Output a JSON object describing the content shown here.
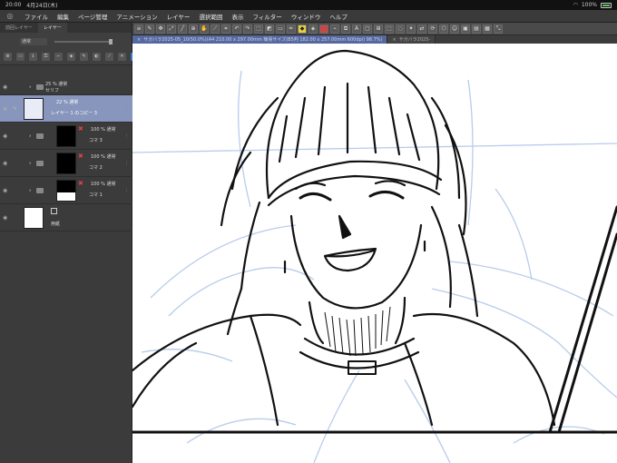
{
  "status": {
    "time": "20:00",
    "date": "4月24日(木)",
    "battery": "100%"
  },
  "menu": {
    "items": [
      "ファイル",
      "編集",
      "ページ管理",
      "アニメーション",
      "レイヤー",
      "選択範囲",
      "表示",
      "フィルター",
      "ウィンドウ",
      "ヘルプ"
    ]
  },
  "doc": {
    "active_tab": "サガバラ2025-05_10(50.0%)(A4 210.00 x 297.00mm 簡易サイズ(B5判 182.00 x 257.00mm 600dpi) 98.7%)",
    "other_tab": "サガバラ2025-"
  },
  "panel": {
    "tab_prev": "前回レイヤー",
    "tab_layer": "レイヤー",
    "blend_mode": "通常"
  },
  "layers": [
    {
      "mode": "25 % 通常",
      "name": "セリフ"
    },
    {
      "mode": "22 % 通常",
      "name": "レイヤー 1 のコピー 3"
    },
    {
      "mode": "100 % 通常",
      "name": "コマ 3"
    },
    {
      "mode": "100 % 通常",
      "name": "コマ 2"
    },
    {
      "mode": "100 % 通常",
      "name": "コマ 1"
    },
    {
      "mode": "",
      "name": "用紙"
    }
  ],
  "colors": {
    "selected_layer": "#8895bc",
    "tab_active": "#5568a0",
    "accent_tool": "#e8d040",
    "sketch_blue": "#b8cceb"
  }
}
